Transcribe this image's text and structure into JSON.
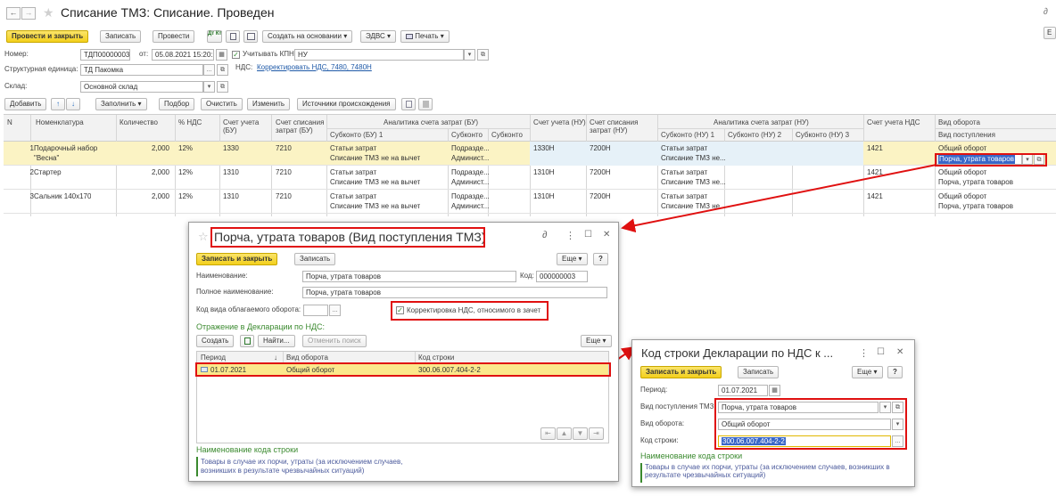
{
  "header": {
    "back": "←",
    "forward": "→",
    "star": "★",
    "title": "Списание ТМЗ: Списание. Проведен",
    "link_icon": "🔗",
    "side_btn": "Е"
  },
  "toolbar": {
    "post_close": "Провести и закрыть",
    "save": "Записать",
    "post": "Провести",
    "dt_kt": "Дт Кт",
    "create_on_basis": "Создать на основании",
    "edvs": "ЭДВС",
    "print": "Печать",
    "dropdown": "▾"
  },
  "fields": {
    "number_label": "Номер:",
    "number_value": "ТДП00000003",
    "from_label": "от:",
    "date_value": "05.08.2021 15:20:23",
    "kpn_label": "Учитывать КПН",
    "kpn_value": "НУ",
    "unit_label": "Структурная единица:",
    "unit_value": "ТД Пакомка",
    "nds_label": "НДС:",
    "nds_link": "Корректировать НДС, 7480, 7480Н",
    "warehouse_label": "Склад:",
    "warehouse_value": "Основной склад",
    "dots": "...",
    "open": "⧉",
    "calendar": "▦"
  },
  "table_toolbar": {
    "add": "Добавить",
    "up": "↑",
    "down": "↓",
    "fill": "Заполнить",
    "select": "Подбор",
    "clear": "Очистить",
    "change": "Изменить",
    "sources": "Источники происхождения"
  },
  "table": {
    "headers": {
      "n": "N",
      "nomen": "Номенклатура",
      "qty": "Количество",
      "nds": "% НДС",
      "acc": "Счет учета",
      "acc2": "(БУ)",
      "wo": "Счет списания",
      "wo2": "затрат (БУ)",
      "anal_bu": "Аналитика счета затрат (БУ)",
      "sub_bu1": "Субконто (БУ) 1",
      "sub": "Субконто",
      "sub2": "Субконто",
      "acc_nu": "Счет учета (НУ)",
      "wo_nu": "Счет списания",
      "wo_nu2": "затрат (НУ)",
      "anal_nu": "Аналитика счета затрат (НУ)",
      "sub_nu1": "Субконто (НУ) 1",
      "sub_nu2": "Субконто (НУ) 2",
      "sub_nu3": "Субконто (НУ) 3",
      "acc_nds": "Счет учета НДС",
      "turnover": "Вид оборота",
      "receipt": "Вид поступления"
    },
    "rows": [
      {
        "n": "1",
        "name": "Подарочный набор",
        "name2": "\"Весна\"",
        "qty": "2,000",
        "nds": "12%",
        "acc": "1330",
        "wo": "7210",
        "sub1a": "Статьи затрат",
        "sub1b": "Списание ТМЗ не на вычет",
        "suba": "Подразде...",
        "subb": "Админист...",
        "acc_nu": "1330Н",
        "wo_nu": "7200Н",
        "nu1a": "Статьи затрат",
        "nu1b": "Списание ТМЗ не...",
        "acc_nds": "1421",
        "turnover": "Общий оборот",
        "receipt": "Порча, утрата товаров"
      },
      {
        "n": "2",
        "name": "Стартер",
        "name2": "",
        "qty": "2,000",
        "nds": "12%",
        "acc": "1310",
        "wo": "7210",
        "sub1a": "Статьи затрат",
        "sub1b": "Списание ТМЗ не на вычет",
        "suba": "Подразде...",
        "subb": "Админист...",
        "acc_nu": "1310Н",
        "wo_nu": "7200Н",
        "nu1a": "Статьи затрат",
        "nu1b": "Списание ТМЗ не...",
        "acc_nds": "1421",
        "turnover": "Общий оборот",
        "receipt": "Порча, утрата товаров"
      },
      {
        "n": "3",
        "name": "Сальник 140х170",
        "name2": "",
        "qty": "2,000",
        "nds": "12%",
        "acc": "1310",
        "wo": "7210",
        "sub1a": "Статьи затрат",
        "sub1b": "Списание ТМЗ не на вычет",
        "suba": "Подразде...",
        "subb": "Админист...",
        "acc_nu": "1310Н",
        "wo_nu": "7200Н",
        "nu1a": "Статьи затрат",
        "nu1b": "Списание ТМЗ не...",
        "acc_nds": "1421",
        "turnover": "Общий оборот",
        "receipt": "Порча, утрата товаров"
      }
    ]
  },
  "dialog1": {
    "star": "☆",
    "title": "Порча, утрата товаров (Вид поступления ТМЗ)",
    "link": "🔗",
    "more": "⋮",
    "max": "☐",
    "close": "✕",
    "save_close": "Записать и закрыть",
    "save": "Записать",
    "more_btn": "Еще",
    "help": "?",
    "name_label": "Наименование:",
    "name_value": "Порча, утрата товаров",
    "code_label": "Код:",
    "code_value": "000000003",
    "full_label": "Полное наименование:",
    "full_value": "Порча, утрата товаров",
    "taxable_label": "Код вида облагаемого оборота:",
    "nds_corr": "Корректировка НДС, относимого в зачет",
    "section": "Отражение в Декларации по НДС:",
    "create": "Создать",
    "find": "Найти...",
    "cancel_find": "Отменить поиск",
    "col_period": "Период",
    "col_sort": "↓",
    "col_turnover": "Вид оборота",
    "col_code": "Код строки",
    "row_period": "01.07.2021",
    "row_turnover": "Общий оборот",
    "row_code": "300.06.007.404-2-2",
    "nav": [
      "⇤",
      "▲",
      "▼",
      "⇥"
    ],
    "code_name_title": "Наименование кода строки",
    "code_name_text1": "Товары в случае их порчи, утраты (за исключением случаев,",
    "code_name_text2": "возникших в результате чрезвычайных ситуаций)"
  },
  "dialog2": {
    "title": "Код строки Декларации по НДС к ...",
    "more": "⋮",
    "max": "☐",
    "close": "✕",
    "save_close": "Записать и закрыть",
    "save": "Записать",
    "more_btn": "Еще",
    "help": "?",
    "period_label": "Период:",
    "period_value": "01.07.2021",
    "receipt_label": "Вид поступления ТМЗ:",
    "receipt_value": "Порча, утрата товаров",
    "turnover_label": "Вид оборота:",
    "turnover_value": "Общий оборот",
    "code_label": "Код строки:",
    "code_value": "300.06.007.404-2-2",
    "code_name_title": "Наименование кода строки",
    "code_name_text1": "Товары в случае их порчи, утраты (за исключением случаев, возникших в",
    "code_name_text2": "результате чрезвычайных ситуаций)"
  },
  "colors": {
    "accent_yellow": "#f5d22a",
    "highlight_row": "#fbf3c4",
    "annotation_red": "#e01010",
    "green_header": "#3b8a2f",
    "link_blue": "#1f5aa8"
  }
}
